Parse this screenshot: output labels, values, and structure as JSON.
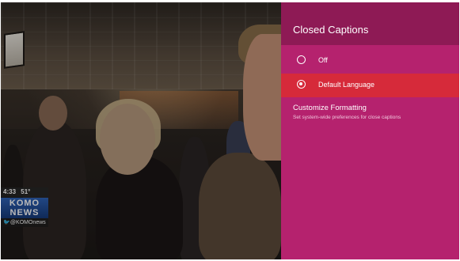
{
  "news_bug": {
    "time": "4:33",
    "temperature": "51°",
    "logo_line1": "KOMO",
    "logo_line2": "NEWS",
    "handle": "🐦@KOMOnews"
  },
  "captions_panel": {
    "title": "Closed Captions",
    "options": [
      {
        "label": "Off",
        "selected": false
      },
      {
        "label": "Default Language",
        "selected": true
      }
    ],
    "customize": {
      "title": "Customize Formatting",
      "description": "Set system-wide preferences for close captions"
    }
  },
  "colors": {
    "panel_background": "#b5226e",
    "panel_header": "#8e1a55",
    "selected_option": "#d62a3a"
  }
}
